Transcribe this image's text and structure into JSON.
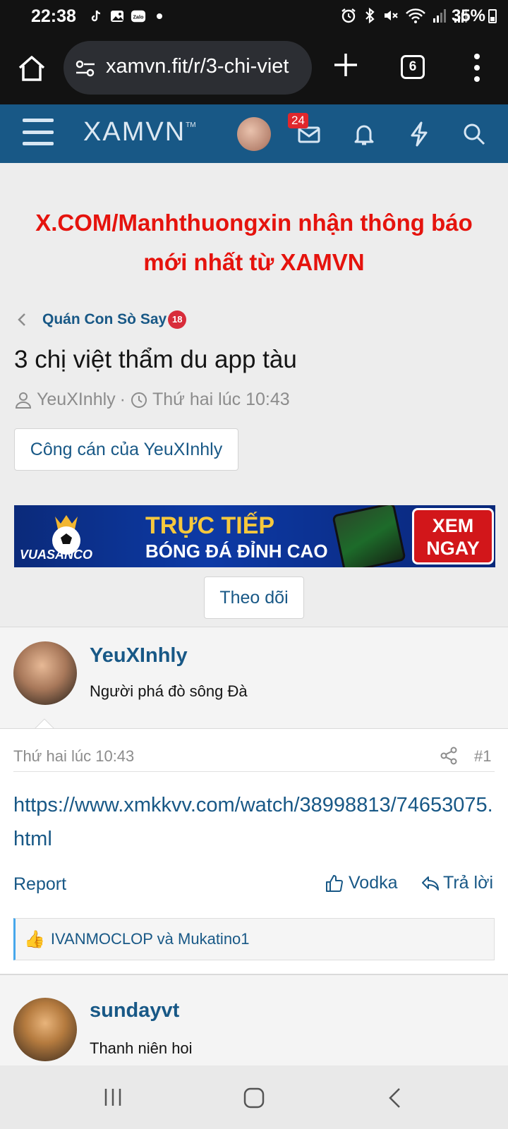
{
  "status_bar": {
    "time": "22:38",
    "battery": "35%",
    "left_icons": [
      "tiktok-icon",
      "gallery-icon",
      "zalo-icon",
      "dot-icon"
    ],
    "right_icons": [
      "alarm-icon",
      "bluetooth-icon",
      "mute-icon",
      "wifi-icon",
      "signal-icon",
      "signal-icon"
    ]
  },
  "browser": {
    "url": "xamvn.fit/r/3-chi-viet",
    "tab_count": "6"
  },
  "header": {
    "logo": "XAMVN",
    "logo_tm": "TM",
    "mail_badge": "24",
    "icons": [
      "menu-icon",
      "mail-icon",
      "bell-icon",
      "bolt-icon",
      "search-icon"
    ]
  },
  "notice": "X.COM/Manhthuongxin nhận thông báo mới nhất từ XAMVN",
  "breadcrumb": {
    "label": "Quán Con Sò Say",
    "badge": "18"
  },
  "thread": {
    "title": "3 chị việt thẩm du app tàu",
    "author": "YeuXInhly",
    "separator": "·",
    "time": "Thứ hai lúc 10:43",
    "author_button": "Công cán của YeuXInhly"
  },
  "banner": {
    "brand": "VUASANCO",
    "line1": "TRỰC TIẾP",
    "line2": "BÓNG ĐÁ ĐỈNH CAO",
    "cta_line1": "XEM",
    "cta_line2": "NGAY"
  },
  "follow_button": "Theo dõi",
  "post1": {
    "username": "YeuXInhly",
    "user_title": "Người phá đò sông Đà",
    "date": "Thứ hai lúc 10:43",
    "number": "#1",
    "link": "https://www.xmkkvv.com/watch/38998813/74653075.html",
    "report": "Report",
    "like": "Vodka",
    "reply": "Trả lời",
    "reactions": "IVANMOCLOP và Mukatino1"
  },
  "post2": {
    "username": "sundayvt",
    "user_title": "Thanh niên hoi"
  },
  "colors": {
    "header_bg": "#185886",
    "link": "#185886",
    "notice": "#e5130d",
    "status_bg": "#121212"
  }
}
